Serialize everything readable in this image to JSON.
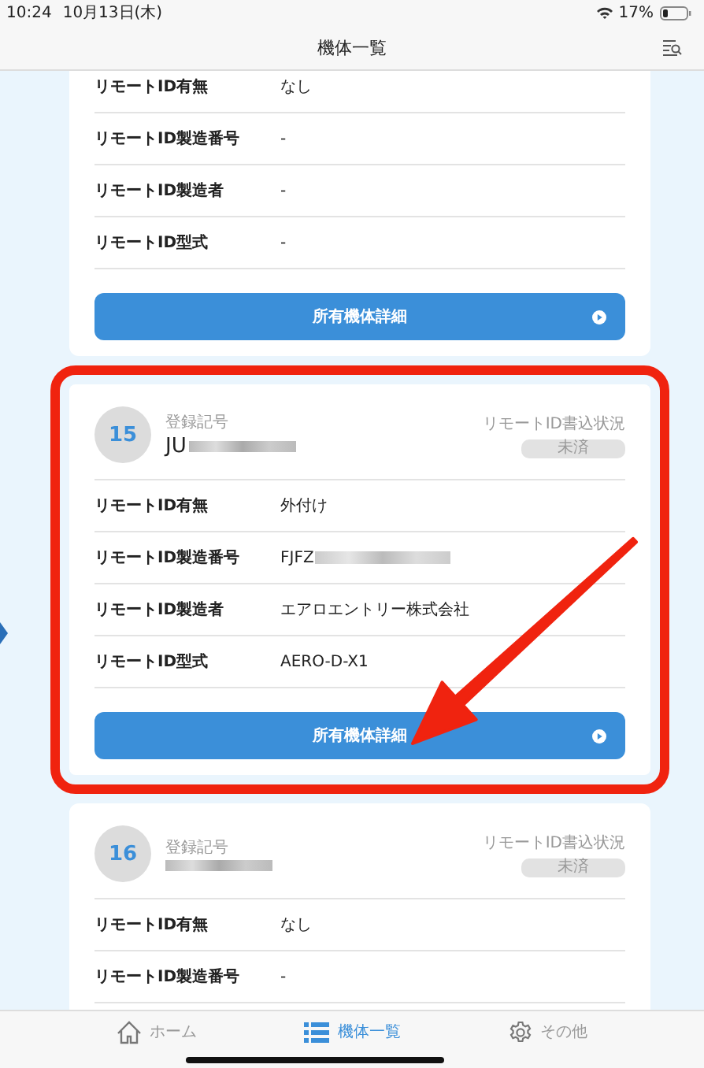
{
  "status_bar": {
    "time": "10:24",
    "date": "10月13日(木)",
    "battery": "17%"
  },
  "nav": {
    "title": "機体一覧"
  },
  "cards": [
    {
      "highlighted": false,
      "rows": [
        {
          "label": "リモートID有無",
          "value": "なし"
        },
        {
          "label": "リモートID製造番号",
          "value": "-"
        },
        {
          "label": "リモートID製造者",
          "value": "-"
        },
        {
          "label": "リモートID型式",
          "value": "-"
        }
      ],
      "button": "所有機体詳細"
    },
    {
      "highlighted": true,
      "header": {
        "number": "15",
        "reg_label": "登録記号",
        "reg_value": "JU",
        "status_label": "リモートID書込状況",
        "status": "未済"
      },
      "rows": [
        {
          "label": "リモートID有無",
          "value": "外付け"
        },
        {
          "label": "リモートID製造番号",
          "value": "FJFZ",
          "blurred": true
        },
        {
          "label": "リモートID製造者",
          "value": "エアロエントリー株式会社"
        },
        {
          "label": "リモートID型式",
          "value": "AERO-D-X1"
        }
      ],
      "button": "所有機体詳細"
    },
    {
      "highlighted": false,
      "header": {
        "number": "16",
        "reg_label": "登録記号",
        "status_label": "リモートID書込状況",
        "status": "未済"
      },
      "rows": [
        {
          "label": "リモートID有無",
          "value": "なし"
        },
        {
          "label": "リモートID製造番号",
          "value": "-"
        }
      ]
    }
  ],
  "tabs": [
    {
      "label": "ホーム",
      "kind": "home",
      "selected": false
    },
    {
      "label": "機体一覧",
      "kind": "list",
      "selected": true
    },
    {
      "label": "その他",
      "kind": "gear",
      "selected": false
    }
  ]
}
